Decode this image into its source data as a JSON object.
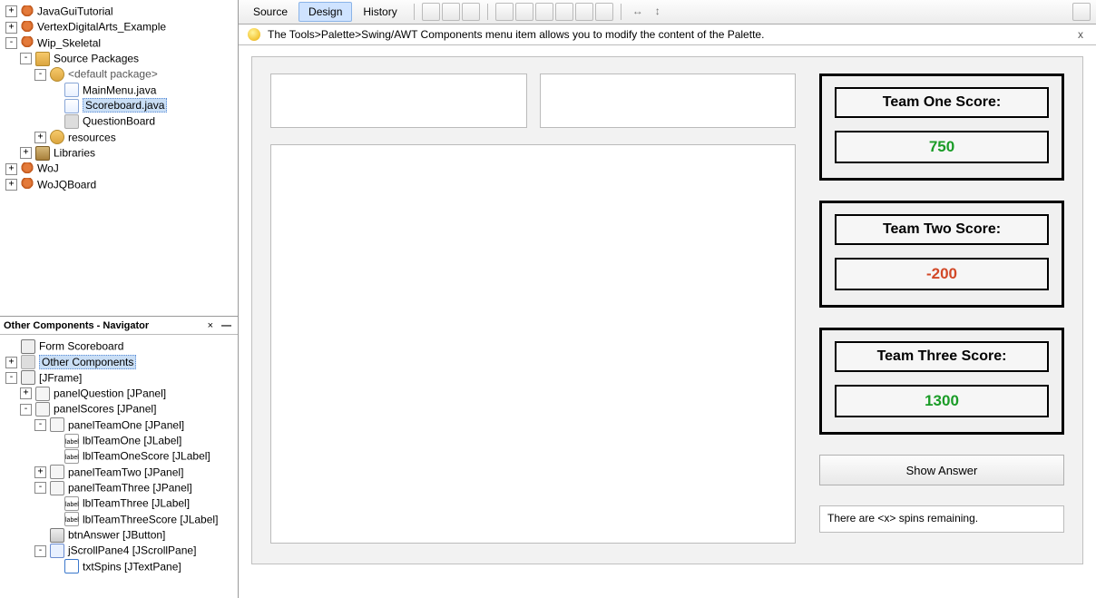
{
  "projects": {
    "p0": "JavaGuiTutorial",
    "p1": "VertexDigitalArts_Example",
    "p2": "Wip_Skeletal",
    "srcPackages": "Source Packages",
    "defaultPkg": "<default package>",
    "mainMenu": "MainMenu.java",
    "scoreboard": "Scoreboard.java",
    "questionBoard": "QuestionBoard",
    "resources": "resources",
    "libraries": "Libraries",
    "p3": "WoJ",
    "p4": "WoJQBoard"
  },
  "navigator": {
    "title": "Other Components - Navigator",
    "formRoot": "Form Scoreboard",
    "otherComponents": "Other Components",
    "jframe": "[JFrame]",
    "panelQuestion": "panelQuestion [JPanel]",
    "panelScores": "panelScores [JPanel]",
    "panelTeamOne": "panelTeamOne [JPanel]",
    "lblTeamOne": "lblTeamOne [JLabel]",
    "lblTeamOneScore": "lblTeamOneScore [JLabel]",
    "panelTeamTwo": "panelTeamTwo [JPanel]",
    "panelTeamThree": "panelTeamThree [JPanel]",
    "lblTeamThree": "lblTeamThree [JLabel]",
    "lblTeamThreeScore": "lblTeamThreeScore [JLabel]",
    "btnAnswer": "btnAnswer [JButton]",
    "jScrollPane4": "jScrollPane4 [JScrollPane]",
    "txtSpins": "txtSpins [JTextPane]"
  },
  "toolbar": {
    "source": "Source",
    "design": "Design",
    "history": "History"
  },
  "tip": {
    "text": "The Tools>Palette>Swing/AWT Components menu item allows you to modify the content of the Palette."
  },
  "form": {
    "team1": {
      "title": "Team One Score:",
      "value": "750"
    },
    "team2": {
      "title": "Team Two Score:",
      "value": "-200"
    },
    "team3": {
      "title": "Team Three Score:",
      "value": "1300"
    },
    "btn": "Show Answer",
    "spins": "There are <x> spins remaining."
  }
}
